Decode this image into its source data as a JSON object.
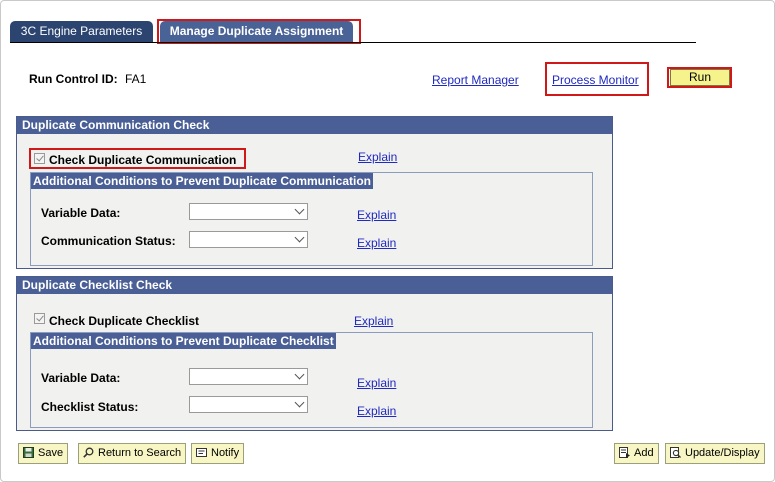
{
  "tabs": [
    {
      "label": "3C Engine Parameters"
    },
    {
      "label": "Manage Duplicate Assignment"
    }
  ],
  "header": {
    "run_control_label": "Run Control ID:",
    "run_control_value": "FA1",
    "report_manager": "Report Manager",
    "process_monitor": "Process Monitor",
    "run": "Run"
  },
  "comm_group": {
    "title": "Duplicate Communication Check",
    "checkbox_label": "Check Duplicate Communication",
    "checked": true,
    "explain": "Explain",
    "sub_title": "Additional Conditions to Prevent Duplicate Communication",
    "fields": [
      {
        "label": "Variable Data:",
        "value": "",
        "explain": "Explain"
      },
      {
        "label": "Communication Status:",
        "value": "",
        "explain": "Explain"
      }
    ]
  },
  "check_group": {
    "title": "Duplicate Checklist Check",
    "checkbox_label": "Check Duplicate Checklist",
    "checked": true,
    "explain": "Explain",
    "sub_title": "Additional Conditions to Prevent Duplicate Checklist",
    "fields": [
      {
        "label": "Variable Data:",
        "value": "",
        "explain": "Explain"
      },
      {
        "label": "Checklist Status:",
        "value": "",
        "explain": "Explain"
      }
    ]
  },
  "toolbar": {
    "save": "Save",
    "return_to_search": "Return to Search",
    "notify": "Notify",
    "add": "Add",
    "update_display": "Update/Display"
  },
  "icons": {
    "save": "save-icon",
    "return": "magnifier-icon",
    "notify": "notify-icon",
    "add": "add-icon",
    "update": "update-icon"
  },
  "colors": {
    "tab_active": "#4a6396",
    "tab_inactive": "#2b4470",
    "header_bar": "#4a5f95",
    "highlight": "#d01818",
    "link": "#1f2ac0",
    "run_button": "#f7f38c"
  }
}
